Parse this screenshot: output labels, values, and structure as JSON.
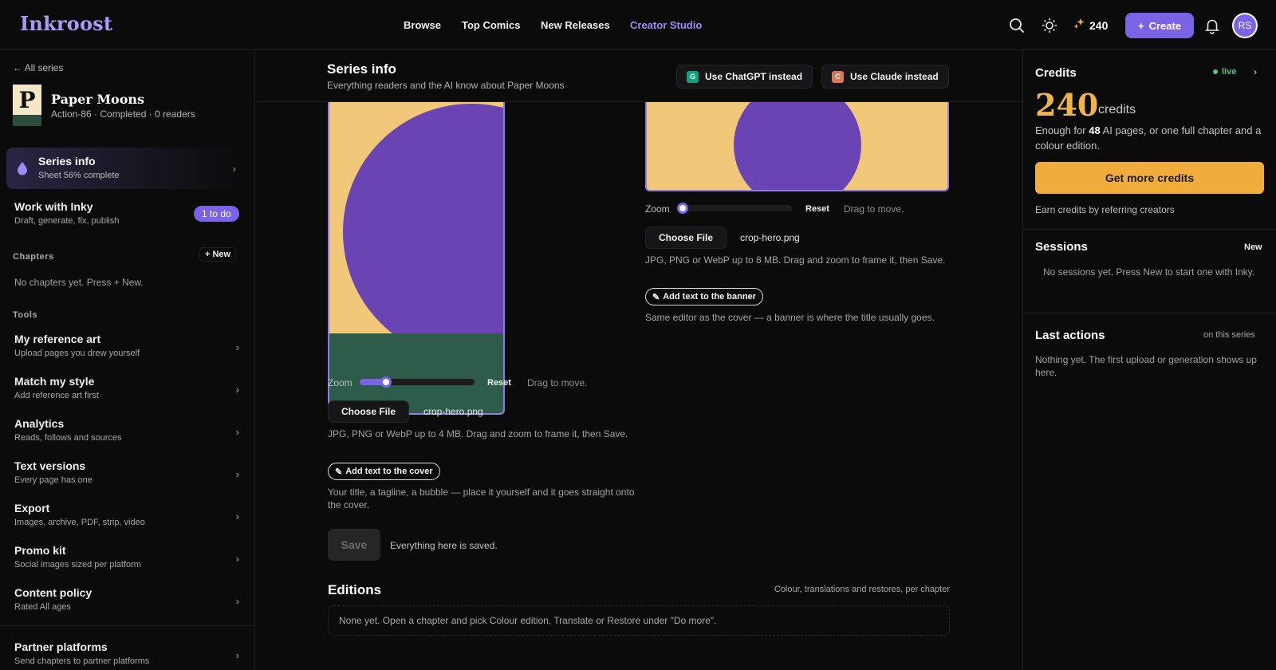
{
  "app": {
    "logo": "Inkroost"
  },
  "nav": {
    "browse": "Browse",
    "top_comics": "Top Comics",
    "new_releases": "New Releases",
    "creator_studio": "Creator Studio"
  },
  "topbar": {
    "credits": "240",
    "create_label": "Create",
    "avatar_initials": "RS"
  },
  "sidebar": {
    "back": "All series",
    "cover_letter": "P",
    "series_title": "Paper Moons",
    "series_meta": "Action-86 · Completed · 0 readers",
    "series_info": {
      "title": "Series info",
      "sub": "Sheet 56% complete"
    },
    "work": {
      "title": "Work with Inky",
      "sub": "Draft, generate, fix, publish",
      "badge": "1 to do"
    },
    "chapters_heading": "Chapters",
    "chapters_new": "+ New",
    "chapters_empty": "No chapters yet. Press + New.",
    "tools_heading": "Tools",
    "tools": [
      {
        "title": "My reference art",
        "sub": "Upload pages you drew yourself"
      },
      {
        "title": "Match my style",
        "sub": "Add reference art first"
      },
      {
        "title": "Analytics",
        "sub": "Reads, follows and sources"
      },
      {
        "title": "Text versions",
        "sub": "Every page has one"
      },
      {
        "title": "Export",
        "sub": "Images, archive, PDF, strip, video"
      },
      {
        "title": "Promo kit",
        "sub": "Social images sized per platform"
      },
      {
        "title": "Content policy",
        "sub": "Rated All ages"
      }
    ],
    "partner": {
      "title": "Partner platforms",
      "sub": "Send chapters to partner platforms"
    }
  },
  "main": {
    "title": "Series info",
    "subtitle": "Everything readers and the AI know about Paper Moons",
    "chatgpt": {
      "badge": "G",
      "label": "Use ChatGPT instead"
    },
    "claude": {
      "badge": "C",
      "label": "Use Claude instead"
    },
    "cover": {
      "zoom_label": "Zoom",
      "zoom_level": 0.2,
      "reset": "Reset",
      "drag": "Drag to move.",
      "choose": "Choose File",
      "file": "crop-hero.png",
      "help": "JPG, PNG or WebP up to 4 MB. Drag and zoom to frame it, then Save.",
      "add_text": "Add text to the cover",
      "add_text_help": "Your title, a tagline, a bubble — place it yourself and it goes straight onto the cover."
    },
    "banner": {
      "zoom_label": "Zoom",
      "zoom_level": 0.0,
      "reset": "Reset",
      "drag": "Drag to move.",
      "choose": "Choose File",
      "file": "crop-hero.png",
      "help": "JPG, PNG or WebP up to 8 MB. Drag and zoom to frame it, then Save.",
      "add_text": "Add text to the banner",
      "add_text_help": "Same editor as the cover — a banner is where the title usually goes."
    },
    "save": "Save",
    "saved_status": "Everything here is saved.",
    "editions_title": "Editions",
    "editions_right": "Colour, translations and restores, per chapter",
    "editions_empty": "None yet. Open a chapter and pick Colour edition, Translate or Restore under \"Do more\"."
  },
  "right": {
    "credits_title": "Credits",
    "live": "live",
    "credits_value": "240",
    "credits_unit": "credits",
    "enough_pre": "Enough for ",
    "enough_num": "48",
    "enough_post": " AI pages, or one full chapter and a colour edition.",
    "get_more": "Get more credits",
    "earn": "Earn credits by referring creators",
    "sessions_title": "Sessions",
    "sessions_new": "New",
    "sessions_empty": "No sessions yet. Press New to start one with Inky.",
    "last_title": "Last actions",
    "last_scope": "on this series",
    "last_empty": "Nothing yet. The first upload or generation shows up here."
  },
  "colors": {
    "accent": "#7b63e6",
    "gold": "#f0ad3c",
    "live": "#5dc07a",
    "cover_bg": "#f1c879",
    "moon": "#6a44b3",
    "ground": "#2e5c4a"
  }
}
